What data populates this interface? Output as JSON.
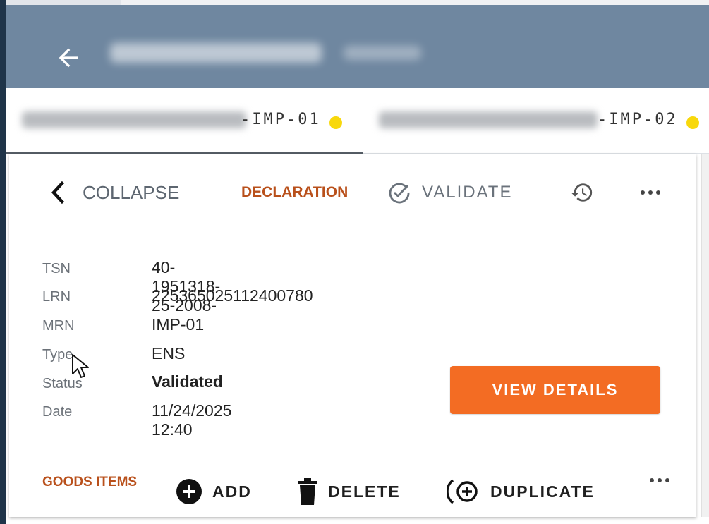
{
  "tabs": [
    {
      "suffix": "-IMP-01",
      "active": true,
      "status_color": "#f8d80c"
    },
    {
      "suffix": "-IMP-02",
      "active": false,
      "status_color": "#f8d80c"
    }
  ],
  "toolbar": {
    "collapse_label": "COLLAPSE",
    "declaration_label": "DECLARATION",
    "validate_label": "VALIDATE"
  },
  "fields": [
    {
      "label": "TSN",
      "value": "40-1951318-25-2008-IMP-01"
    },
    {
      "label": "LRN",
      "value": "225365025112400780"
    },
    {
      "label": "MRN",
      "value": ""
    },
    {
      "label": "Type",
      "value": "ENS"
    },
    {
      "label": "Status",
      "value": "Validated"
    },
    {
      "label": "Date",
      "value": "11/24/2025 12:40"
    }
  ],
  "view_details_label": "VIEW DETAILS",
  "goods": {
    "label": "GOODS ITEMS",
    "add_label": "ADD",
    "delete_label": "DELETE",
    "duplicate_label": "DUPLICATE"
  },
  "colors": {
    "appbar": "#6f87a0",
    "accent": "#f36c23",
    "section_label": "#b9501b",
    "status_dot": "#f8d80c"
  },
  "icons": [
    "arrow-back-icon",
    "chevron-left-icon",
    "check-circle-icon",
    "history-icon",
    "more-horizontal-icon",
    "add-circle-icon",
    "trash-icon",
    "duplicate-icon",
    "mouse-cursor-icon"
  ]
}
